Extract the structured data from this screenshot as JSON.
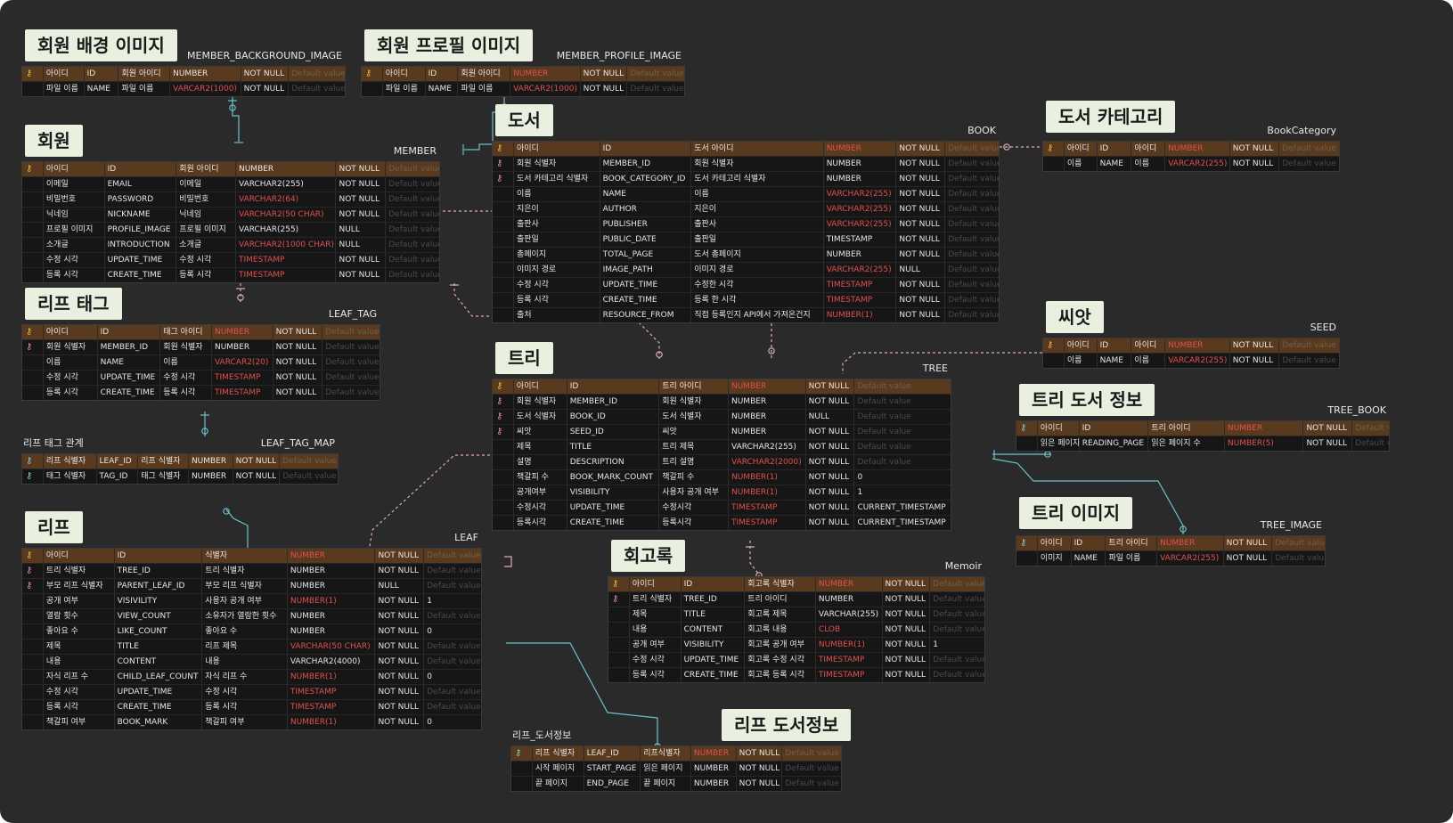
{
  "colors": {
    "background": "#2a2a2b",
    "pk_row": "#5a3a1e",
    "label_bg": "#e9f0df",
    "red_type": "#e05050",
    "pink_line": "#e2a9bd",
    "cyan_line": "#6cc2c9"
  },
  "icons": {
    "key": "key-icon",
    "fk": "foreign-key-icon",
    "pfk": "primary-foreign-key-icon"
  },
  "tables": [
    {
      "label": "회원 배경 이미지",
      "name": "MEMBER_BACKGROUND_IMAGE",
      "rows": [
        {
          "icon": "key",
          "logical": "아이디",
          "physical": "ID",
          "comment": "회원 아이디",
          "type": "NUMBER",
          "null": "NOT NULL",
          "default": "Default value"
        },
        {
          "icon": "",
          "logical": "파일 이름",
          "physical": "NAME",
          "comment": "파일 이름",
          "type": "VARCAR2(1000)",
          "null": "NOT NULL",
          "default": "Default value"
        }
      ]
    },
    {
      "label": "회원 프로필 이미지",
      "name": "MEMBER_PROFILE_IMAGE",
      "rows": [
        {
          "icon": "key",
          "logical": "아이디",
          "physical": "ID",
          "comment": "회원 아이디",
          "type": "NUMBER",
          "null": "NOT NULL",
          "default": "Default value"
        },
        {
          "icon": "",
          "logical": "파일 이름",
          "physical": "NAME",
          "comment": "파일 이름",
          "type": "VARCAR2(1000)",
          "null": "NOT NULL",
          "default": "Default value"
        }
      ]
    },
    {
      "label": "회원",
      "name": "MEMBER",
      "rows": [
        {
          "icon": "key",
          "logical": "아이디",
          "physical": "ID",
          "comment": "회원 아이디",
          "type": "NUMBER",
          "null": "NOT NULL",
          "default": "Default value"
        },
        {
          "icon": "",
          "logical": "이메일",
          "physical": "EMAIL",
          "comment": "이메일",
          "type": "VARCHAR2(255)",
          "null": "NOT NULL",
          "default": "Default value"
        },
        {
          "icon": "",
          "logical": "비밀번호",
          "physical": "PASSWORD",
          "comment": "비밀번호",
          "type": "VARCHAR2(64)",
          "null": "NOT NULL",
          "default": "Default value"
        },
        {
          "icon": "",
          "logical": "닉네임",
          "physical": "NICKNAME",
          "comment": "닉네임",
          "type": "VARCHAR2(50 CHAR)",
          "null": "NOT NULL",
          "default": "Default value"
        },
        {
          "icon": "",
          "logical": "프로필 이미지",
          "physical": "PROFILE_IMAGE",
          "comment": "프로필 이미지",
          "type": "VARCHAR(255)",
          "null": "NULL",
          "default": "Default value"
        },
        {
          "icon": "",
          "logical": "소개글",
          "physical": "INTRODUCTION",
          "comment": "소개글",
          "type": "VARCHAR2(1000 CHAR)",
          "null": "NULL",
          "default": "Default value"
        },
        {
          "icon": "",
          "logical": "수정 시각",
          "physical": "UPDATE_TIME",
          "comment": "수정 시각",
          "type": "TIMESTAMP",
          "null": "NOT NULL",
          "default": "Default value"
        },
        {
          "icon": "",
          "logical": "등록 시각",
          "physical": "CREATE_TIME",
          "comment": "등록 시각",
          "type": "TIMESTAMP",
          "null": "NOT NULL",
          "default": "Default value"
        }
      ]
    },
    {
      "label": "리프 태그",
      "name": "LEAF_TAG",
      "rows": [
        {
          "icon": "key",
          "logical": "아이디",
          "physical": "ID",
          "comment": "태그 아이디",
          "type": "NUMBER",
          "null": "NOT NULL",
          "default": "Default value"
        },
        {
          "icon": "fk",
          "logical": "회원 식별자",
          "physical": "MEMBER_ID",
          "comment": "회원 식별자",
          "type": "NUMBER",
          "null": "NOT NULL",
          "default": "Default value"
        },
        {
          "icon": "",
          "logical": "이름",
          "physical": "NAME",
          "comment": "이름",
          "type": "VARCAR2(20)",
          "null": "NOT NULL",
          "default": "Default value"
        },
        {
          "icon": "",
          "logical": "수정 시각",
          "physical": "UPDATE_TIME",
          "comment": "수정 시각",
          "type": "TIMESTAMP",
          "null": "NOT NULL",
          "default": "Default value"
        },
        {
          "icon": "",
          "logical": "등록 시각",
          "physical": "CREATE_TIME",
          "comment": "등록 시각",
          "type": "TIMESTAMP",
          "null": "NOT NULL",
          "default": "Default value"
        }
      ]
    },
    {
      "label": "",
      "name": "LEAF_TAG_MAP",
      "title_left": "리프 태그 관계",
      "rows": [
        {
          "icon": "pfk",
          "logical": "리프 식별자",
          "physical": "LEAF_ID",
          "comment": "리프 식별자",
          "type": "NUMBER",
          "null": "NOT NULL",
          "default": "Default value"
        },
        {
          "icon": "pfk",
          "logical": "태그 식별자",
          "physical": "TAG_ID",
          "comment": "태그 식별자",
          "type": "NUMBER",
          "null": "NOT NULL",
          "default": "Default value"
        }
      ]
    },
    {
      "label": "리프",
      "name": "LEAF",
      "rows": [
        {
          "icon": "key",
          "logical": "아이디",
          "physical": "ID",
          "comment": "식별자",
          "type": "NUMBER",
          "null": "NOT NULL",
          "default": "Default value"
        },
        {
          "icon": "fk",
          "logical": "트리 식별자",
          "physical": "TREE_ID",
          "comment": "트리 식별자",
          "type": "NUMBER",
          "null": "NOT NULL",
          "default": "Default value"
        },
        {
          "icon": "fk",
          "logical": "부모 리프 식별자",
          "physical": "PARENT_LEAF_ID",
          "comment": "부모 리프 식별자",
          "type": "NUMBER",
          "null": "NULL",
          "default": "Default value"
        },
        {
          "icon": "",
          "logical": "공개 여부",
          "physical": "VISIVILITY",
          "comment": "사용자 공개 여부",
          "type": "NUMBER(1)",
          "null": "NOT NULL",
          "default": "1"
        },
        {
          "icon": "",
          "logical": "열람 횟수",
          "physical": "VIEW_COUNT",
          "comment": "소유자가 열람한 횟수",
          "type": "NUMBER",
          "null": "NOT NULL",
          "default": "Default value"
        },
        {
          "icon": "",
          "logical": "좋아요 수",
          "physical": "LIKE_COUNT",
          "comment": "좋아요 수",
          "type": "NUMBER",
          "null": "NOT NULL",
          "default": "0"
        },
        {
          "icon": "",
          "logical": "제목",
          "physical": "TITLE",
          "comment": "리프 제목",
          "type": "VARCHAR(50 CHAR)",
          "null": "NOT NULL",
          "default": "Default value"
        },
        {
          "icon": "",
          "logical": "내용",
          "physical": "CONTENT",
          "comment": "내용",
          "type": "VARCHAR2(4000)",
          "null": "NOT NULL",
          "default": "Default value"
        },
        {
          "icon": "",
          "logical": "자식 리프 수",
          "physical": "CHILD_LEAF_COUNT",
          "comment": "자식 리프 수",
          "type": "NUMBER(1)",
          "null": "NOT NULL",
          "default": "0"
        },
        {
          "icon": "",
          "logical": "수정 시각",
          "physical": "UPDATE_TIME",
          "comment": "수정 시각",
          "type": "TIMESTAMP",
          "null": "NOT NULL",
          "default": "Default value"
        },
        {
          "icon": "",
          "logical": "등록 시각",
          "physical": "CREATE_TIME",
          "comment": "등록 시각",
          "type": "TIMESTAMP",
          "null": "NOT NULL",
          "default": "Default value"
        },
        {
          "icon": "",
          "logical": "책갈피 여부",
          "physical": "BOOK_MARK",
          "comment": "책갈피 여부",
          "type": "NUMBER(1)",
          "null": "NOT NULL",
          "default": "0"
        }
      ]
    },
    {
      "label": "도서",
      "name": "BOOK",
      "rows": [
        {
          "icon": "key",
          "logical": "아이디",
          "physical": "ID",
          "comment": "도서 아이디",
          "type": "NUMBER",
          "null": "NOT NULL",
          "default": "Default value"
        },
        {
          "icon": "fk",
          "logical": "회원 식별자",
          "physical": "MEMBER_ID",
          "comment": "회원 식별자",
          "type": "NUMBER",
          "null": "NOT NULL",
          "default": "Default value"
        },
        {
          "icon": "fk",
          "logical": "도서 카테고리 식별자",
          "physical": "BOOK_CATEGORY_ID",
          "comment": "도서 카테고리 식별자",
          "type": "NUMBER",
          "null": "NOT NULL",
          "default": "Default value"
        },
        {
          "icon": "",
          "logical": "이름",
          "physical": "NAME",
          "comment": "이름",
          "type": "VARCHAR2(255)",
          "null": "NOT NULL",
          "default": "Default value"
        },
        {
          "icon": "",
          "logical": "지은이",
          "physical": "AUTHOR",
          "comment": "지은이",
          "type": "VARCHAR2(255)",
          "null": "NOT NULL",
          "default": "Default value"
        },
        {
          "icon": "",
          "logical": "출판사",
          "physical": "PUBLISHER",
          "comment": "출판사",
          "type": "VARCHAR2(255)",
          "null": "NOT NULL",
          "default": "Default value"
        },
        {
          "icon": "",
          "logical": "출판일",
          "physical": "PUBLIC_DATE",
          "comment": "출판일",
          "type": "TIMESTAMP",
          "null": "NOT NULL",
          "default": "Default value"
        },
        {
          "icon": "",
          "logical": "총페이지",
          "physical": "TOTAL_PAGE",
          "comment": "도서 총페이지",
          "type": "NUMBER",
          "null": "NOT NULL",
          "default": "Default value"
        },
        {
          "icon": "",
          "logical": "이미지 경로",
          "physical": "IMAGE_PATH",
          "comment": "이미지 경로",
          "type": "VARCHAR2(255)",
          "null": "NULL",
          "default": "Default value"
        },
        {
          "icon": "",
          "logical": "수정 시각",
          "physical": "UPDATE_TIME",
          "comment": "수정한 시각",
          "type": "TIMESTAMP",
          "null": "NOT NULL",
          "default": "Default value"
        },
        {
          "icon": "",
          "logical": "등록 시각",
          "physical": "CREATE_TIME",
          "comment": "등록 한 시각",
          "type": "TIMESTAMP",
          "null": "NOT NULL",
          "default": "Default value"
        },
        {
          "icon": "",
          "logical": "출처",
          "physical": "RESOURCE_FROM",
          "comment": "직접 등록인지 API에서 가져온건지",
          "type": "NUMBER(1)",
          "null": "NOT NULL",
          "default": "Default value"
        }
      ]
    },
    {
      "label": "도서 카테고리",
      "name": "BookCategory",
      "rows": [
        {
          "icon": "key",
          "logical": "아이디",
          "physical": "ID",
          "comment": "아이디",
          "type": "NUMBER",
          "null": "NOT NULL",
          "default": "Default value"
        },
        {
          "icon": "",
          "logical": "이름",
          "physical": "NAME",
          "comment": "이름",
          "type": "VARCAR2(255)",
          "null": "NOT NULL",
          "default": "Default value"
        }
      ]
    },
    {
      "label": "씨앗",
      "name": "SEED",
      "rows": [
        {
          "icon": "key",
          "logical": "아이디",
          "physical": "ID",
          "comment": "아이디",
          "type": "NUMBER",
          "null": "NOT NULL",
          "default": "Default value"
        },
        {
          "icon": "",
          "logical": "이름",
          "physical": "NAME",
          "comment": "이름",
          "type": "VARCAR2(255)",
          "null": "NOT NULL",
          "default": "Default value"
        }
      ]
    },
    {
      "label": "트리",
      "name": "TREE",
      "rows": [
        {
          "icon": "key",
          "logical": "아이디",
          "physical": "ID",
          "comment": "트리 아이디",
          "type": "NUMBER",
          "null": "NOT NULL",
          "default": "Default value"
        },
        {
          "icon": "fk",
          "logical": "회원 식별자",
          "physical": "MEMBER_ID",
          "comment": "회원 식별자",
          "type": "NUMBER",
          "null": "NOT NULL",
          "default": "Default value"
        },
        {
          "icon": "fk",
          "logical": "도서 식별자",
          "physical": "BOOK_ID",
          "comment": "도서 식별자",
          "type": "NUMBER",
          "null": "NULL",
          "default": "Default value"
        },
        {
          "icon": "fk",
          "logical": "씨앗",
          "physical": "SEED_ID",
          "comment": "씨앗",
          "type": "NUMBER",
          "null": "NOT NULL",
          "default": "Default value"
        },
        {
          "icon": "",
          "logical": "제목",
          "physical": "TITLE",
          "comment": "트리 제목",
          "type": "VARCHAR2(255)",
          "null": "NOT NULL",
          "default": "Default value"
        },
        {
          "icon": "",
          "logical": "설명",
          "physical": "DESCRIPTION",
          "comment": "트리 설명",
          "type": "VARCHAR2(2000)",
          "null": "NOT NULL",
          "default": "Default value"
        },
        {
          "icon": "",
          "logical": "책갈피 수",
          "physical": "BOOK_MARK_COUNT",
          "comment": "책갈피 수",
          "type": "NUMBER(1)",
          "null": "NOT NULL",
          "default": "0"
        },
        {
          "icon": "",
          "logical": "공개여부",
          "physical": "VISIBILITY",
          "comment": "사용자 공개 여부",
          "type": "NUMBER(1)",
          "null": "NOT NULL",
          "default": "1"
        },
        {
          "icon": "",
          "logical": "수정시각",
          "physical": "UPDATE_TIME",
          "comment": "수정시각",
          "type": "TIMESTAMP",
          "null": "NOT NULL",
          "default": "CURRENT_TIMESTAMP"
        },
        {
          "icon": "",
          "logical": "등록시각",
          "physical": "CREATE_TIME",
          "comment": "등록시각",
          "type": "TIMESTAMP",
          "null": "NOT NULL",
          "default": "CURRENT_TIMESTAMP"
        }
      ]
    },
    {
      "label": "트리 도서 정보",
      "name": "TREE_BOOK",
      "rows": [
        {
          "icon": "pfk",
          "logical": "아이디",
          "physical": "ID",
          "comment": "트리 아이디",
          "type": "NUMBER",
          "null": "NOT NULL",
          "default": "Default value"
        },
        {
          "icon": "",
          "logical": "읽은 페이지 수",
          "physical": "READING_PAGE",
          "comment": "읽은 페이지 수",
          "type": "NUMBER(5)",
          "null": "NOT NULL",
          "default": "Default value"
        }
      ]
    },
    {
      "label": "트리 이미지",
      "name": "TREE_IMAGE",
      "rows": [
        {
          "icon": "pfk",
          "logical": "아이디",
          "physical": "ID",
          "comment": "트리 아이디",
          "type": "NUMBER",
          "null": "NOT NULL",
          "default": "Default value"
        },
        {
          "icon": "",
          "logical": "이미지",
          "physical": "NAME",
          "comment": "파일 이름",
          "type": "VARCAR2(255)",
          "null": "NOT NULL",
          "default": "Default value"
        }
      ]
    },
    {
      "label": "회고록",
      "name": "Memoir",
      "rows": [
        {
          "icon": "key",
          "logical": "아이디",
          "physical": "ID",
          "comment": "회고록 식별자",
          "type": "NUMBER",
          "null": "NOT NULL",
          "default": "Default value"
        },
        {
          "icon": "fk",
          "logical": "트리 식별자",
          "physical": "TREE_ID",
          "comment": "트리 아이디",
          "type": "NUMBER",
          "null": "NOT NULL",
          "default": "Default value"
        },
        {
          "icon": "",
          "logical": "제목",
          "physical": "TITLE",
          "comment": "회고록 제목",
          "type": "VARCHAR(255)",
          "null": "NOT NULL",
          "default": "Default value"
        },
        {
          "icon": "",
          "logical": "내용",
          "physical": "CONTENT",
          "comment": "회고록 내용",
          "type": "CLOB",
          "null": "NOT NULL",
          "default": "Default value"
        },
        {
          "icon": "",
          "logical": "공개 여부",
          "physical": "VISIBILITY",
          "comment": "회고록 공개 여부",
          "type": "NUMBER(1)",
          "null": "NOT NULL",
          "default": "1"
        },
        {
          "icon": "",
          "logical": "수정 시각",
          "physical": "UPDATE_TIME",
          "comment": "회고록 수정 시각",
          "type": "TIMESTAMP",
          "null": "NOT NULL",
          "default": "Default value"
        },
        {
          "icon": "",
          "logical": "등록 시각",
          "physical": "CREATE_TIME",
          "comment": "회고록 등록 시각",
          "type": "TIMESTAMP",
          "null": "NOT NULL",
          "default": "Default value"
        }
      ]
    },
    {
      "label": "리프 도서정보",
      "name": "",
      "title_left": "리프_도서정보",
      "rows": [
        {
          "icon": "pfk",
          "logical": "리프 식별자",
          "physical": "LEAF_ID",
          "comment": "리프식별자",
          "type": "NUMBER",
          "null": "NOT NULL",
          "default": "Default value"
        },
        {
          "icon": "",
          "logical": "시작 페이지",
          "physical": "START_PAGE",
          "comment": "읽은 페이지",
          "type": "NUMBER",
          "null": "NOT NULL",
          "default": "Default value"
        },
        {
          "icon": "",
          "logical": "끝 페이지",
          "physical": "END_PAGE",
          "comment": "끝 페이지",
          "type": "NUMBER",
          "null": "NOT NULL",
          "default": "Default value"
        }
      ]
    }
  ]
}
